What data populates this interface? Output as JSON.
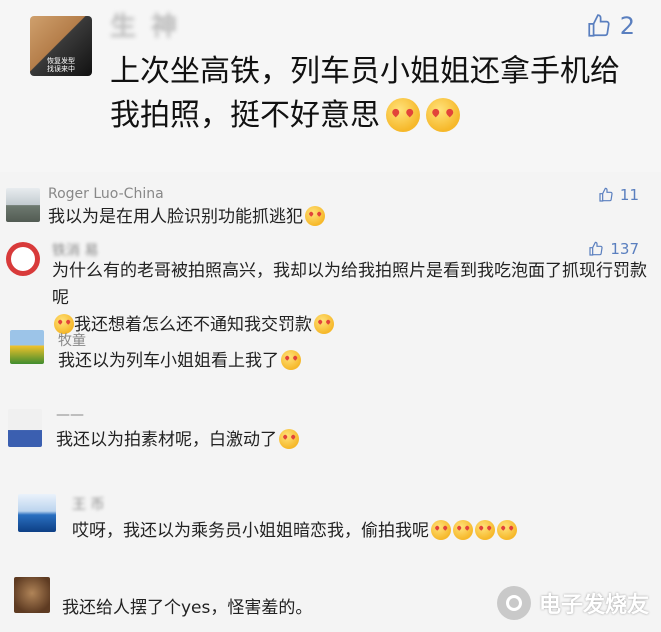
{
  "main_post": {
    "username": "生 神",
    "avatar_caption": "恢复发型\n找误来中",
    "like_count": "2",
    "text": "上次坐高铁，列车员小姐姐还拿手机给我拍照，挺不好意思"
  },
  "comments": [
    {
      "username": "Roger Luo-China",
      "text": "我以为是在用人脸识别功能抓逃犯",
      "likes": "11"
    },
    {
      "username": "铁消  易",
      "text": "为什么有的老哥被拍照高兴，我却以为给我拍照片是看到我吃泡面了抓现行罚款呢",
      "text2": "我还想着怎么还不通知我交罚款",
      "likes": "137"
    },
    {
      "username": "牧童",
      "text": "我还以为列车小姐姐看上我了"
    },
    {
      "username": "——",
      "text": "我还以为拍素材呢，白激动了"
    },
    {
      "username": "王  币",
      "text": "哎呀，我还以为乘务员小姐姐暗恋我，偷拍我呢"
    },
    {
      "username": "",
      "text": "我还给人摆了个yes，怪害羞的。"
    }
  ],
  "watermark": "电子发烧友",
  "colors": {
    "accent": "#5a7fbf",
    "background": "#f4f4f4"
  }
}
